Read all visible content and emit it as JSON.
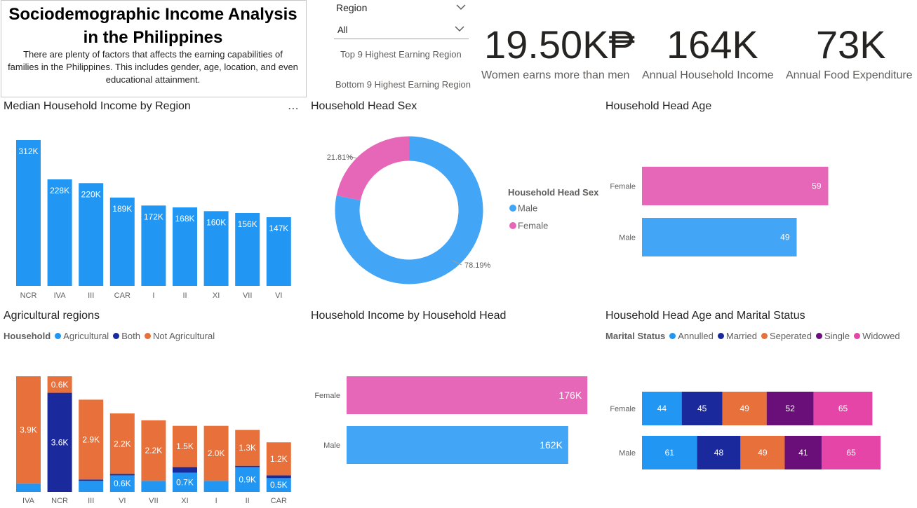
{
  "header": {
    "title": "Sociodemographic Income Analysis in the Philippines",
    "description": "There are plenty of factors that affects the earning capabilities of families in the Philippines. This includes gender, age, location, and even educational attainment."
  },
  "slicer": {
    "label": "Region",
    "value": "All",
    "button_top": "Top 9 Highest Earning Region",
    "button_bottom": "Bottom 9 Highest Earning Region"
  },
  "kpis": [
    {
      "value": "19.50K₱",
      "label": "Women earns more than men"
    },
    {
      "value": "164K",
      "label": "Annual Household Income"
    },
    {
      "value": "73K",
      "label": "Annual Food Expenditure"
    }
  ],
  "colors": {
    "blue": "#2196f3",
    "light_blue": "#42a5f5",
    "navy": "#1a2a9c",
    "orange": "#e8703a",
    "pink": "#e667b8",
    "purple": "#6a0f7a",
    "magenta": "#e645a8"
  },
  "sections": {
    "median_income": "Median Household Income by Region",
    "head_sex": "Household Head Sex",
    "head_age": "Household Head Age",
    "agri": "Agricultural regions",
    "income_by_head": "Household Income by Household Head",
    "age_marital": "Household Head Age and Marital Status"
  },
  "chart_data": [
    {
      "id": "median_income",
      "type": "bar",
      "title": "Median Household Income by Region",
      "categories": [
        "NCR",
        "IVA",
        "III",
        "CAR",
        "I",
        "II",
        "XI",
        "VII",
        "VI"
      ],
      "values": [
        312,
        228,
        220,
        189,
        172,
        168,
        160,
        156,
        147
      ],
      "data_labels": [
        "312K",
        "228K",
        "220K",
        "189K",
        "172K",
        "168K",
        "160K",
        "156K",
        "147K"
      ],
      "unit": "K"
    },
    {
      "id": "head_sex",
      "type": "pie",
      "title": "Household Head Sex",
      "legend_title": "Household Head Sex",
      "labels": [
        "Male",
        "Female"
      ],
      "values": [
        78.19,
        21.81
      ],
      "data_labels": [
        "78.19%",
        "21.81%"
      ],
      "colors": [
        "#42a5f5",
        "#e667b8"
      ]
    },
    {
      "id": "head_age",
      "type": "bar",
      "orientation": "horizontal",
      "title": "Household Head Age",
      "categories": [
        "Female",
        "Male"
      ],
      "values": [
        59,
        49
      ],
      "data_labels": [
        "59",
        "49"
      ],
      "colors": [
        "#e667b8",
        "#42a5f5"
      ]
    },
    {
      "id": "agri",
      "type": "bar",
      "stacked": true,
      "title": "Agricultural regions",
      "legend_title": "Household",
      "categories": [
        "IVA",
        "NCR",
        "III",
        "VI",
        "VII",
        "XI",
        "I",
        "II",
        "CAR"
      ],
      "series": [
        {
          "name": "Agricultural",
          "values": [
            0.3,
            0,
            0.4,
            0.6,
            0.4,
            0.7,
            0.4,
            0.9,
            0.5
          ],
          "data_labels": [
            "",
            "",
            "",
            "0.6K",
            "",
            "0.7K",
            "",
            "0.9K",
            "0.5K"
          ]
        },
        {
          "name": "Both",
          "values": [
            0,
            3.6,
            0.05,
            0.05,
            0,
            0.2,
            0,
            0.05,
            0.1
          ],
          "data_labels": [
            "",
            "3.6K",
            "",
            "",
            "",
            "",
            "",
            "",
            ""
          ]
        },
        {
          "name": "Not Agricultural",
          "values": [
            3.9,
            0.6,
            2.9,
            2.2,
            2.2,
            1.5,
            2.0,
            1.3,
            1.2
          ],
          "data_labels": [
            "3.9K",
            "0.6K",
            "2.9K",
            "2.2K",
            "2.2K",
            "1.5K",
            "2.0K",
            "1.3K",
            "1.2K"
          ]
        }
      ]
    },
    {
      "id": "income_by_head",
      "type": "bar",
      "orientation": "horizontal",
      "title": "Household Income by Household Head",
      "categories": [
        "Female",
        "Male"
      ],
      "values": [
        176,
        162
      ],
      "data_labels": [
        "176K",
        "162K"
      ],
      "colors": [
        "#e667b8",
        "#42a5f5"
      ]
    },
    {
      "id": "age_marital",
      "type": "bar",
      "orientation": "horizontal",
      "stacked": true,
      "title": "Household Head Age and Marital Status",
      "legend_title": "Marital Status",
      "categories": [
        "Female",
        "Male"
      ],
      "series": [
        {
          "name": "Annulled",
          "values": [
            44,
            61
          ]
        },
        {
          "name": "Married",
          "values": [
            45,
            48
          ]
        },
        {
          "name": "Seperated",
          "values": [
            49,
            49
          ]
        },
        {
          "name": "Single",
          "values": [
            52,
            41
          ]
        },
        {
          "name": "Widowed",
          "values": [
            65,
            65
          ]
        }
      ]
    }
  ]
}
